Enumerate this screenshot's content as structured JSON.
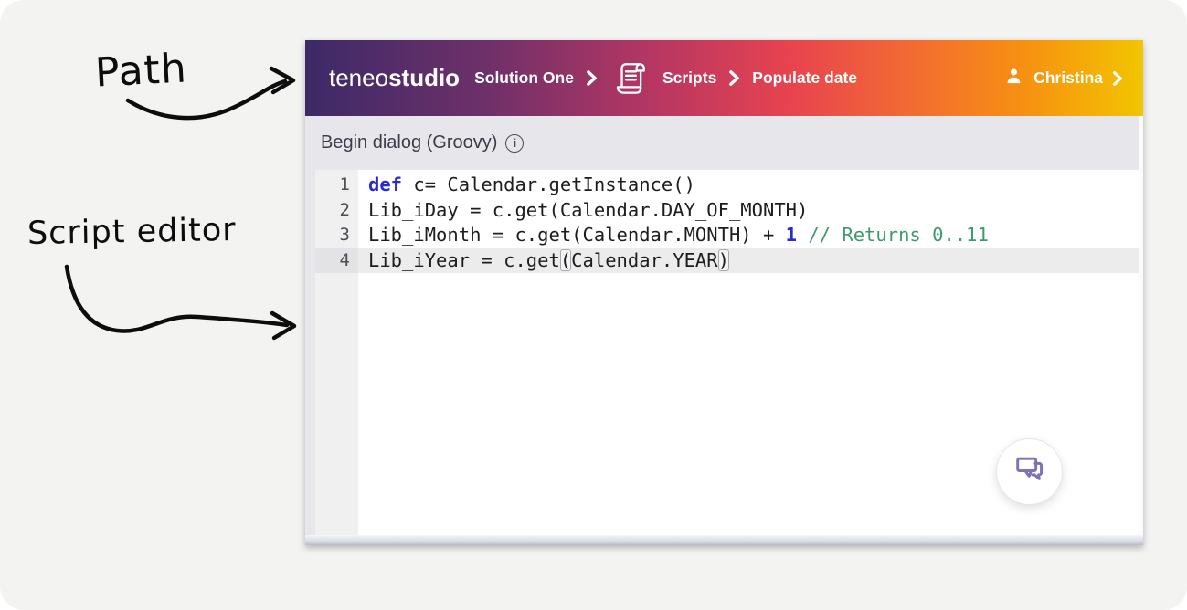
{
  "annotations": {
    "path": "Path",
    "script_editor": "Script editor"
  },
  "header": {
    "logo_regular": "teneo",
    "logo_bold": "studio",
    "breadcrumb": {
      "solution": "Solution One",
      "scripts": "Scripts",
      "page": "Populate date"
    },
    "user_name": "Christina"
  },
  "editor": {
    "title": "Begin dialog (Groovy)",
    "language": "Groovy",
    "lines": [
      {
        "n": "1",
        "active": false,
        "segments": [
          {
            "t": "def",
            "c": "keyword"
          },
          {
            "t": " c= Calendar.getInstance()",
            "c": "plain"
          }
        ]
      },
      {
        "n": "2",
        "active": false,
        "segments": [
          {
            "t": "Lib_iDay = c.get(Calendar.DAY_OF_MONTH)",
            "c": "plain"
          }
        ]
      },
      {
        "n": "3",
        "active": false,
        "segments": [
          {
            "t": "Lib_iMonth = c.get(Calendar.MONTH) + ",
            "c": "plain"
          },
          {
            "t": "1",
            "c": "number"
          },
          {
            "t": " ",
            "c": "plain"
          },
          {
            "t": "// Returns 0..11",
            "c": "comment"
          }
        ]
      },
      {
        "n": "4",
        "active": true,
        "segments": [
          {
            "t": "Lib_iYear = c.get",
            "c": "plain"
          },
          {
            "t": "(",
            "c": "bracket"
          },
          {
            "t": "Calendar.YEAR",
            "c": "plain"
          },
          {
            "t": ")",
            "c": "bracket"
          }
        ]
      }
    ]
  },
  "icons": {
    "breadcrumb_scripts": "scroll-icon",
    "breadcrumb_separator": "chevron-right-icon",
    "user": "user-icon",
    "info": "info-icon",
    "info_glyph": "i",
    "chat": "chat-bubbles-icon"
  },
  "colors": {
    "header_gradient": [
      "#3c2a67",
      "#6f3069",
      "#b83762",
      "#e8434f",
      "#f26a33",
      "#f79111",
      "#f2c500"
    ],
    "keyword_blue": "#2929d6",
    "comment_green": "#3f9970",
    "code_text": "#1d1d1d",
    "active_line_bg": "#ececec",
    "chat_icon_purple": "#7c72b4",
    "annotation_ink": "#0d0d0d"
  }
}
